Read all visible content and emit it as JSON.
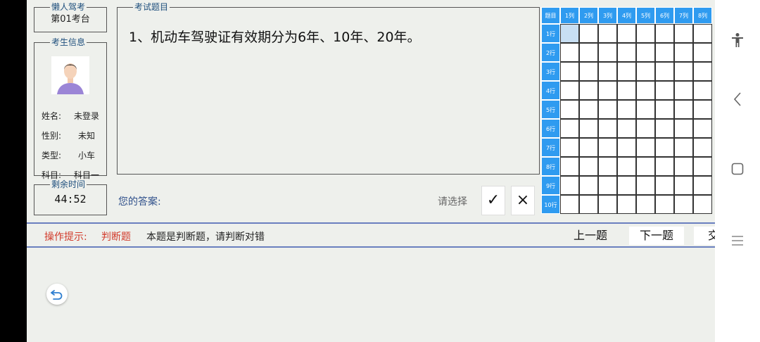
{
  "station": {
    "legend": "懒人驾考",
    "value": "第01考台"
  },
  "candidate": {
    "legend": "考生信息",
    "rows": [
      {
        "key": "姓名:",
        "value": "未登录"
      },
      {
        "key": "性别:",
        "value": "未知"
      },
      {
        "key": "类型:",
        "value": "小车"
      },
      {
        "key": "科目:",
        "value": "科目一"
      }
    ]
  },
  "timer": {
    "legend": "剩余时间",
    "value": "44:52"
  },
  "question": {
    "legend": "考试题目",
    "text": "1、机动车驾驶证有效期分为6年、10年、20年。"
  },
  "answer": {
    "label": "您的答案:",
    "hint": "请选择",
    "correct_symbol": "✓",
    "wrong_symbol": "×"
  },
  "grid": {
    "corner": "题目",
    "columns": [
      "1列",
      "2列",
      "3列",
      "4列",
      "5列",
      "6列",
      "7列",
      "8列"
    ],
    "rows": [
      "1行",
      "2行",
      "3行",
      "4行",
      "5行",
      "6行",
      "7行",
      "8行",
      "9行",
      "10行"
    ],
    "selected": {
      "row": 1,
      "col": 1
    }
  },
  "hint_bar": {
    "label": "操作提示:",
    "type": "判断题",
    "text": "本题是判断题，请判断对错",
    "prev": "上一题",
    "next": "下一题",
    "submit": "交"
  },
  "colors": {
    "accent": "#2f9bf0",
    "hint_red": "#d23b2b",
    "divider": "#6a7fbf",
    "selected_cell": "#c8dff3"
  }
}
